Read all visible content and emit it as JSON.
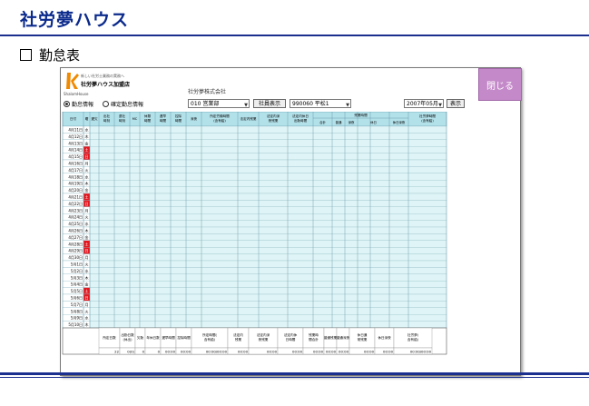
{
  "slide": {
    "title": "社労夢ハウス",
    "bullet": "勤怠表"
  },
  "app": {
    "logo_tagline": "新しい社労士業務の実務へ",
    "logo_name": "社労夢ハウス加盟店",
    "logo_sub": "ShalomHouse",
    "company": "社労夢株式会社",
    "close_label": "閉じる"
  },
  "toolbar": {
    "radio1": "勤怠情報",
    "radio2": "確定勤怠情報",
    "dept": "010 営業部",
    "show_staff_button": "社員表示",
    "staff": "990060 平松1",
    "month": "2007年05月",
    "display_button": "表示"
  },
  "header": {
    "cols": [
      "日付",
      "曜",
      "遅欠",
      "出社時刻",
      "退社時刻",
      "MC",
      "休憩時間",
      "遅早時間",
      "控除時間",
      "深夜",
      "所定労働時間(含有給)",
      "法定内残業",
      "法定内深夜残業",
      "法定内休日出勤時間",
      "",
      "",
      "",
      "",
      "",
      "",
      "社労夢時間(含有給)"
    ],
    "zangyo_group": "残業時間",
    "zangyo_sub": [
      "合計",
      "普通",
      "深夜",
      "休日",
      "休日深夜"
    ]
  },
  "rows": [
    {
      "d": "4月11日",
      "w": "水"
    },
    {
      "d": "4月12日",
      "w": "木"
    },
    {
      "d": "4月13日",
      "w": "金"
    },
    {
      "d": "4月14日",
      "w": "土"
    },
    {
      "d": "4月15日",
      "w": "日"
    },
    {
      "d": "4月16日",
      "w": "月"
    },
    {
      "d": "4月17日",
      "w": "火"
    },
    {
      "d": "4月18日",
      "w": "水"
    },
    {
      "d": "4月19日",
      "w": "木"
    },
    {
      "d": "4月20日",
      "w": "金"
    },
    {
      "d": "4月21日",
      "w": "土"
    },
    {
      "d": "4月22日",
      "w": "日"
    },
    {
      "d": "4月23日",
      "w": "月"
    },
    {
      "d": "4月24日",
      "w": "火"
    },
    {
      "d": "4月25日",
      "w": "水"
    },
    {
      "d": "4月26日",
      "w": "木"
    },
    {
      "d": "4月27日",
      "w": "金"
    },
    {
      "d": "4月28日",
      "w": "土"
    },
    {
      "d": "4月29日",
      "w": "日"
    },
    {
      "d": "4月30日",
      "w": "月"
    },
    {
      "d": "5月1日",
      "w": "火"
    },
    {
      "d": "5月2日",
      "w": "水"
    },
    {
      "d": "5月3日",
      "w": "木"
    },
    {
      "d": "5月4日",
      "w": "金"
    },
    {
      "d": "5月5日",
      "w": "土"
    },
    {
      "d": "5月6日",
      "w": "日"
    },
    {
      "d": "5月7日",
      "w": "月"
    },
    {
      "d": "5月8日",
      "w": "火"
    },
    {
      "d": "5月9日",
      "w": "水"
    },
    {
      "d": "5月10日",
      "w": "木"
    }
  ],
  "summary": {
    "labels": [
      "所定日数",
      "出勤日数(休出)",
      "欠勤",
      "年休日数",
      "遅早時間",
      "控除時間",
      "所定時間(含有給)",
      "法定内残業",
      "法定内深夜残業",
      "法定内休日時間",
      "残業時間合計",
      "普通残業",
      "普通深夜",
      "休日通常残業",
      "休日深夜",
      "社労夢(含有給)"
    ],
    "values": [
      "22",
      "0(0)",
      "0",
      "0",
      "00:00",
      "00:00",
      "00:00/00:00",
      "00:00",
      "00:00",
      "00:00",
      "00:00",
      "00:00",
      "00:00",
      "00:00",
      "00:00",
      "00:00/00:00"
    ]
  },
  "colors": {
    "weekend": "#e8141c",
    "row_bg": "#dff4f6",
    "header_bg": "#b3e1ea",
    "accent": "#c489c9"
  }
}
